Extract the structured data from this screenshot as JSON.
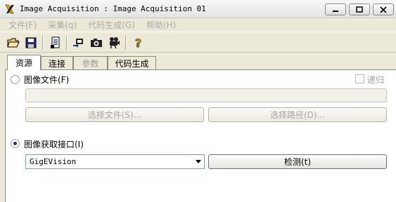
{
  "window": {
    "title": "Image Acquisition : Image Acquisition 01"
  },
  "menu": [
    "文件(F)",
    "采集(q)",
    "代码生成(G)",
    "帮助(H)"
  ],
  "toolbar": {
    "icons": [
      "open-folder-icon",
      "save-icon",
      "properties-icon",
      "connect-camera-icon",
      "snap-icon",
      "live-icon",
      "help-icon"
    ]
  },
  "tabs": [
    {
      "label": "资源",
      "state": "active"
    },
    {
      "label": "连接",
      "state": "normal"
    },
    {
      "label": "参数",
      "state": "disabled"
    },
    {
      "label": "代码生成",
      "state": "normal"
    }
  ],
  "image_files": {
    "radio_label": "图像文件(F)",
    "selected": false,
    "recursive_label": "递归",
    "path_value": "",
    "select_file_label": "选择文件(S)...",
    "select_path_label": "选择路径(D)..."
  },
  "acq_interface": {
    "radio_label": "图像获取接口(I)",
    "selected": true,
    "interface_value": "GigEVision",
    "detect_label": "检测(t)"
  }
}
